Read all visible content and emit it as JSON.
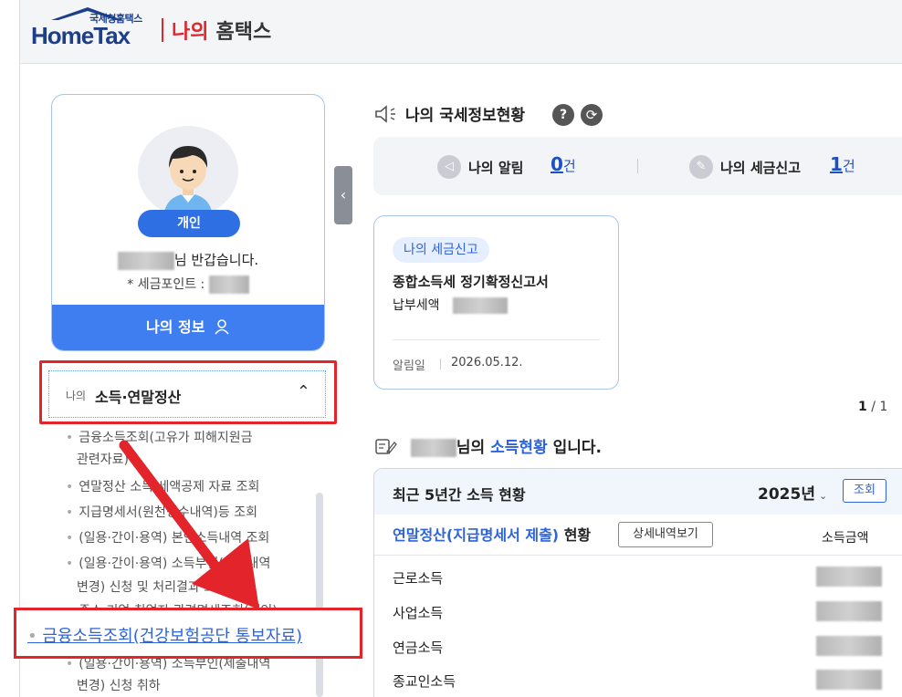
{
  "header": {
    "logo_sub": "국세청홈택스",
    "logo_main": "HomeTax",
    "title_red": "나의",
    "title_dark": "홈택스"
  },
  "profile": {
    "type_tag": "개인",
    "greeting_suffix": "님 반갑습니다.",
    "points_label": "* 세금포인트 :",
    "my_info_button": "나의 정보"
  },
  "menu": {
    "head_small": "나의",
    "head_big": "소득·연말정산",
    "items": [
      "금융소득조회(고유가 피해지원금",
      "관련자료)",
      "연말정산 소득·세액공제 자료 조회",
      "지급명세서(원천징수내역)등 조회",
      "(일용·간이·용역) 본인소득내역 조회",
      "(일용·간이·용역) 소득부인(제출내역",
      "변경) 신청 및 처리결과 조회",
      "종소·기업·취업자 관련명세조회(개인)",
      "(일용·간이·용역) 소득부인(제출내역",
      "변경) 신청 취하"
    ],
    "highlight_link": "금융소득조회(건강보험공단 통보자료)"
  },
  "status": {
    "title": "나의 국세정보현황",
    "alarm_label": "나의 알림",
    "alarm_count": "0",
    "alarm_unit": "건",
    "tax_label": "나의 세금신고",
    "tax_count": "1",
    "tax_unit": "건"
  },
  "notice": {
    "tag": "나의 세금신고",
    "title": "종합소득세 정기확정신고서",
    "amount_label": "납부세액",
    "date_label": "알림일",
    "date_value": "2026.05.12."
  },
  "pager": {
    "current": "1",
    "sep": " / ",
    "total": "1"
  },
  "income": {
    "title_suffix": "님의",
    "title_blue": "소득현황",
    "title_end": "입니다.",
    "panel_title": "최근 5년간 소득 현황",
    "year": "2025년",
    "year_caret": "⌄",
    "query_button": "조회",
    "row_head_blue": "연말정산(지급명세서 제출)",
    "row_head_dark": "현황",
    "detail_button": "상세내역보기",
    "amount_header": "소득금액",
    "rows": [
      "근로소득",
      "사업소득",
      "연금소득",
      "종교인소득"
    ]
  },
  "colors": {
    "brand_blue": "#1d3f8a",
    "accent_blue": "#2f63d9",
    "button_blue": "#3f7ef0",
    "highlight_red": "#e3242b"
  },
  "icons": [
    "speaker-icon",
    "help-icon",
    "refresh-icon",
    "bell-icon",
    "tax-report-icon",
    "user-icon",
    "chevron-up-icon",
    "chevron-left-icon",
    "memo-pen-icon"
  ]
}
